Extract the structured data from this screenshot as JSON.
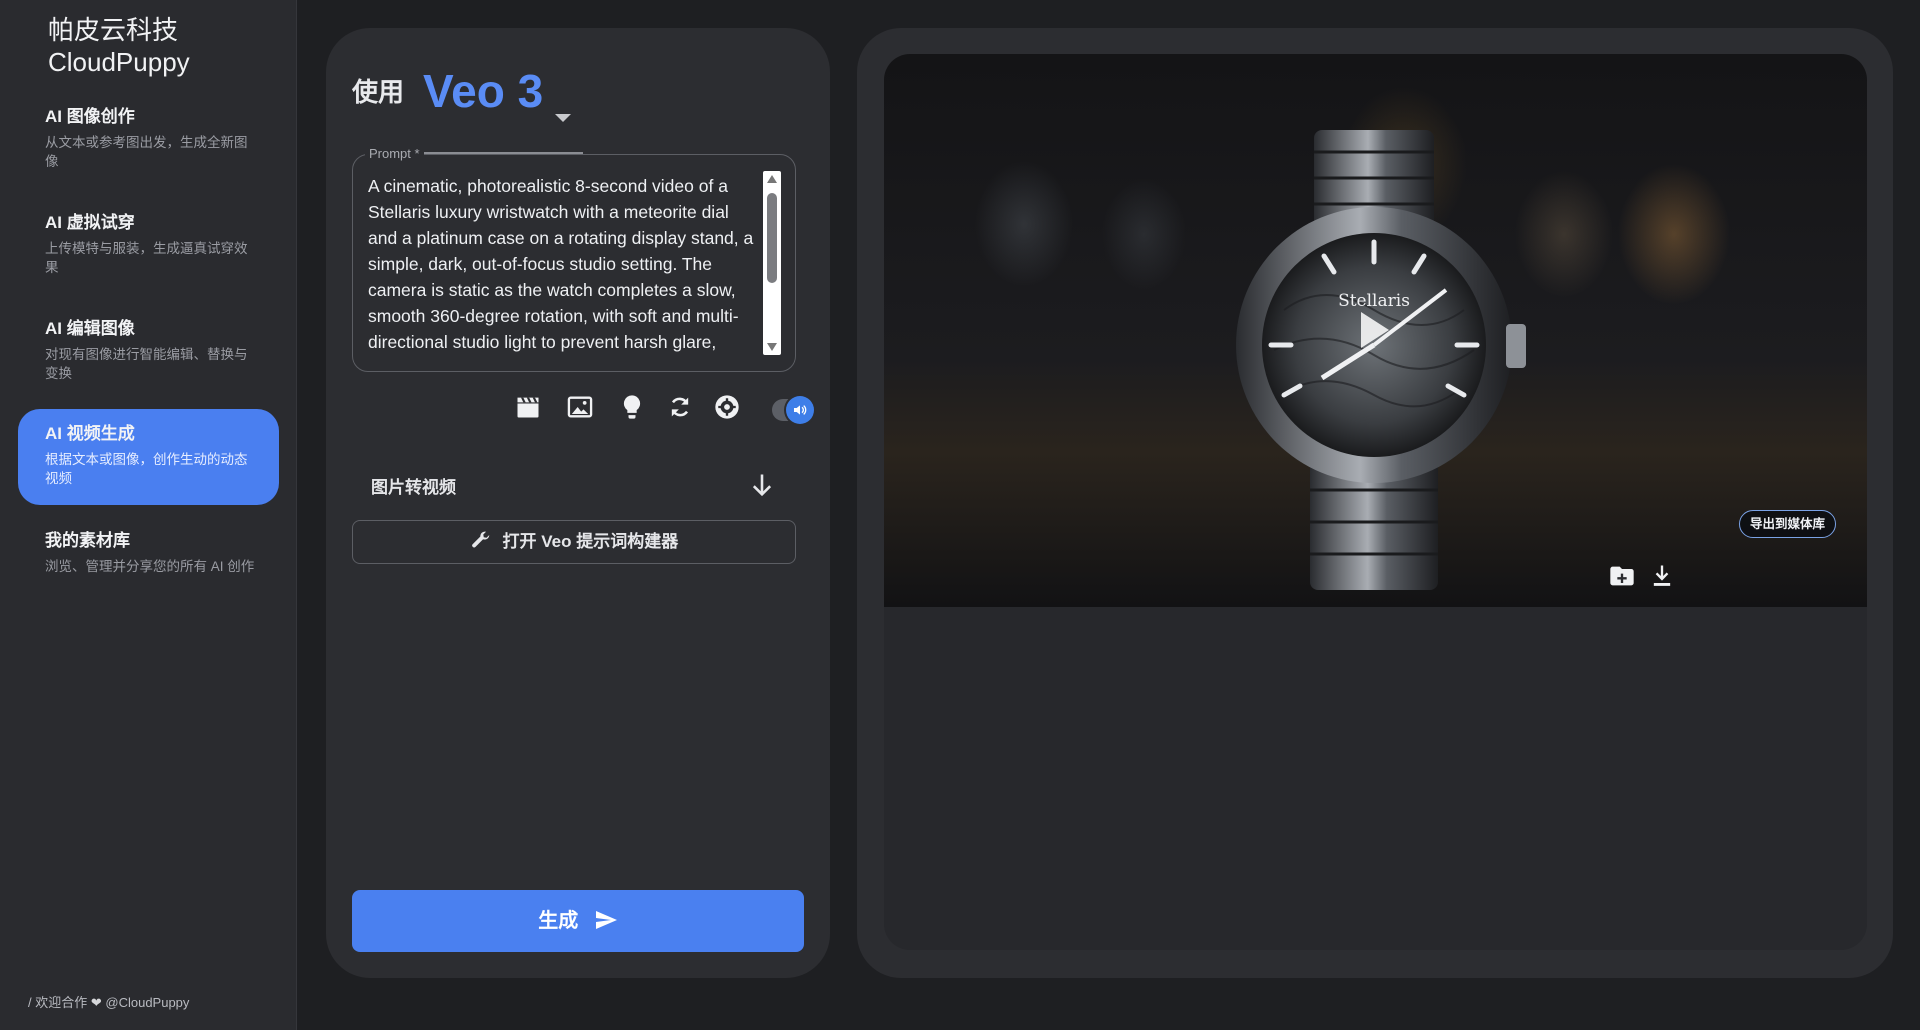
{
  "brand": {
    "line1": "帕皮云科技",
    "line2": "CloudPuppy"
  },
  "sidebar": {
    "items": [
      {
        "title": "AI 图像创作",
        "desc": "从文本或参考图出发，生成全新图像",
        "active": false
      },
      {
        "title": "AI 虚拟试穿",
        "desc": "上传模特与服装，生成逼真试穿效果",
        "active": false
      },
      {
        "title": "AI 编辑图像",
        "desc": "对现有图像进行智能编辑、替换与变换",
        "active": false
      },
      {
        "title": "AI 视频生成",
        "desc": "根据文本或图像，创作生动的动态视频",
        "active": true
      },
      {
        "title": "我的素材库",
        "desc": "浏览、管理并分享您的所有 AI 创作",
        "active": false
      }
    ],
    "footer": {
      "prefix": "/ 欢迎合作",
      "heart": "❤",
      "handle": "@CloudPuppy"
    }
  },
  "left_panel": {
    "use_label": "使用",
    "model": {
      "selected": "Veo 3"
    },
    "prompt": {
      "label": "Prompt *",
      "value": "A cinematic, photorealistic 8-second video of a Stellaris luxury wristwatch with a meteorite dial and a platinum case on a rotating display stand, a simple, dark, out-of-focus studio setting. The camera is static as the watch completes a slow, smooth 360-degree rotation, with soft and multi-directional studio light to prevent harsh glare,"
    },
    "toolbar": {
      "icons": [
        "clapperboard-icon",
        "image-icon",
        "lightbulb-icon",
        "refresh-icon",
        "settings-icon"
      ],
      "audio_toggle_on": true
    },
    "section": {
      "label": "图片转视频"
    },
    "builder_button": {
      "label": "打开 Veo 提示词构建器"
    },
    "generate_button": {
      "label": "生成"
    }
  },
  "right_panel": {
    "video": {
      "watch_brand": "Stellaris",
      "export_label": "导出到媒体库"
    },
    "colors": {
      "accent": "#4a80f0",
      "model_text": "#5a8cf5"
    }
  }
}
